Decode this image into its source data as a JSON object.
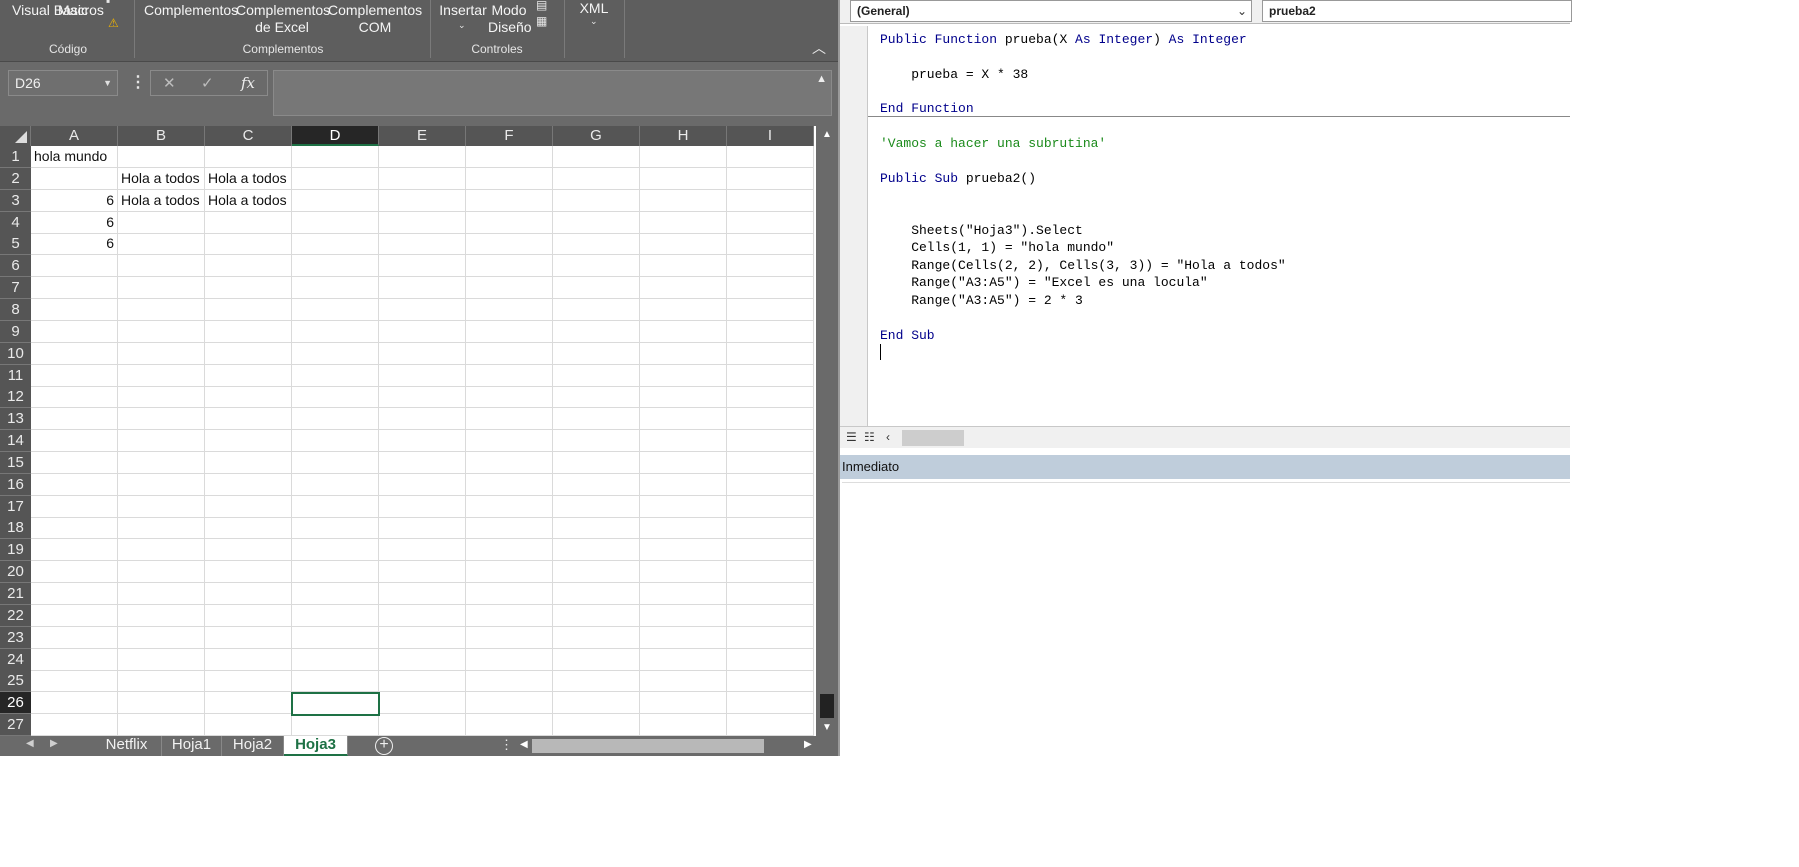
{
  "ribbon": {
    "visual_basic": "Visual Basic",
    "macros": "Macros",
    "complementos": "Complementos",
    "complementos_excel": "Complementos de Excel",
    "complementos_com": "Complementos COM",
    "insertar": "Insertar",
    "modo_diseno": "Modo Diseño",
    "xml": "XML",
    "groups": {
      "codigo": "Código",
      "complementos": "Complementos",
      "controles": "Controles"
    }
  },
  "formula_bar": {
    "name_box": "D26",
    "fx": "fx",
    "formula": ""
  },
  "sheet": {
    "columns": [
      "A",
      "B",
      "C",
      "D",
      "E",
      "F",
      "G",
      "H",
      "I"
    ],
    "selected_column": "D",
    "selected_row": 26,
    "active_cell": "D26",
    "rows": [
      "1",
      "2",
      "3",
      "4",
      "5",
      "6",
      "7",
      "8",
      "9",
      "10",
      "11",
      "12",
      "13",
      "14",
      "15",
      "16",
      "17",
      "18",
      "19",
      "20",
      "21",
      "22",
      "23",
      "24",
      "25",
      "26",
      "27"
    ],
    "cells": {
      "A1": "hola mundo",
      "B2": "Hola a todos",
      "C2": "Hola a todos",
      "A3": "6",
      "B3": "Hola a todos",
      "C3": "Hola a todos",
      "A4": "6",
      "A5": "6"
    }
  },
  "tabs": [
    "Netflix",
    "Hoja1",
    "Hoja2",
    "Hoja3"
  ],
  "active_tab": "Hoja3",
  "vbe": {
    "object_combo": "(General)",
    "procedure_combo": "prueba2",
    "code": {
      "l1_kw1": "Public Function",
      "l1_mid": " prueba(X ",
      "l1_kw2": "As Integer",
      "l1_mid2": ") ",
      "l1_kw3": "As Integer",
      "l2": "    prueba = X * 38",
      "l3": "End Function",
      "l4": "'Vamos a hacer una subrutina'",
      "l5_kw": "Public Sub",
      "l5_rest": " prueba2()",
      "l6": "    Sheets(\"Hoja3\").Select",
      "l7": "    Cells(1, 1) = \"hola mundo\"",
      "l8": "    Range(Cells(2, 2), Cells(3, 3)) = \"Hola a todos\"",
      "l9": "    Range(\"A3:A5\") = \"Excel es una locula\"",
      "l10": "    Range(\"A3:A5\") = 2 * 3",
      "l11": "End Sub"
    },
    "immediate_title": "Inmediato"
  },
  "colors": {
    "excel_green": "#1e7145",
    "ribbon_bg": "#5e5e5e",
    "vba_keyword": "#00008b",
    "vba_comment": "#1b8a1b",
    "immediate_header": "#bfcddb"
  }
}
